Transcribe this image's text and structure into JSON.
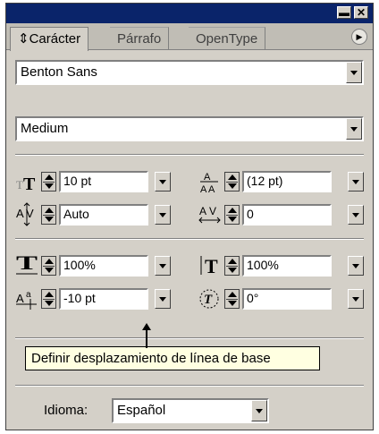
{
  "titlebar": {
    "minimize_glyph": "▬",
    "close_glyph": "✕"
  },
  "tabs": [
    {
      "label": "Carácter",
      "active": true
    },
    {
      "label": "Párrafo",
      "active": false
    },
    {
      "label": "OpenType",
      "active": false
    }
  ],
  "tab_prefix_glyph": "⇕",
  "panel_menu_glyph": "▶",
  "font_family": {
    "value": "Benton Sans"
  },
  "font_style": {
    "value": "Medium"
  },
  "fields": {
    "font_size": "10 pt",
    "leading": "(12 pt)",
    "kerning": "Auto",
    "tracking": "0",
    "horizontal_scale": "100%",
    "vertical_scale": "100%",
    "baseline_shift": "-10 pt",
    "skew": "0°"
  },
  "tooltip": "Definir desplazamiento de línea de base",
  "language": {
    "label": "Idioma:",
    "value": "Español"
  },
  "colors": {
    "titlebar": "#0a246a",
    "panel": "#d4d0c8",
    "tooltip_bg": "#ffffe1"
  },
  "icons": [
    "font-size-icon",
    "leading-icon",
    "kerning-icon",
    "tracking-icon",
    "horizontal-scale-icon",
    "vertical-scale-icon",
    "baseline-shift-icon",
    "skew-icon"
  ]
}
